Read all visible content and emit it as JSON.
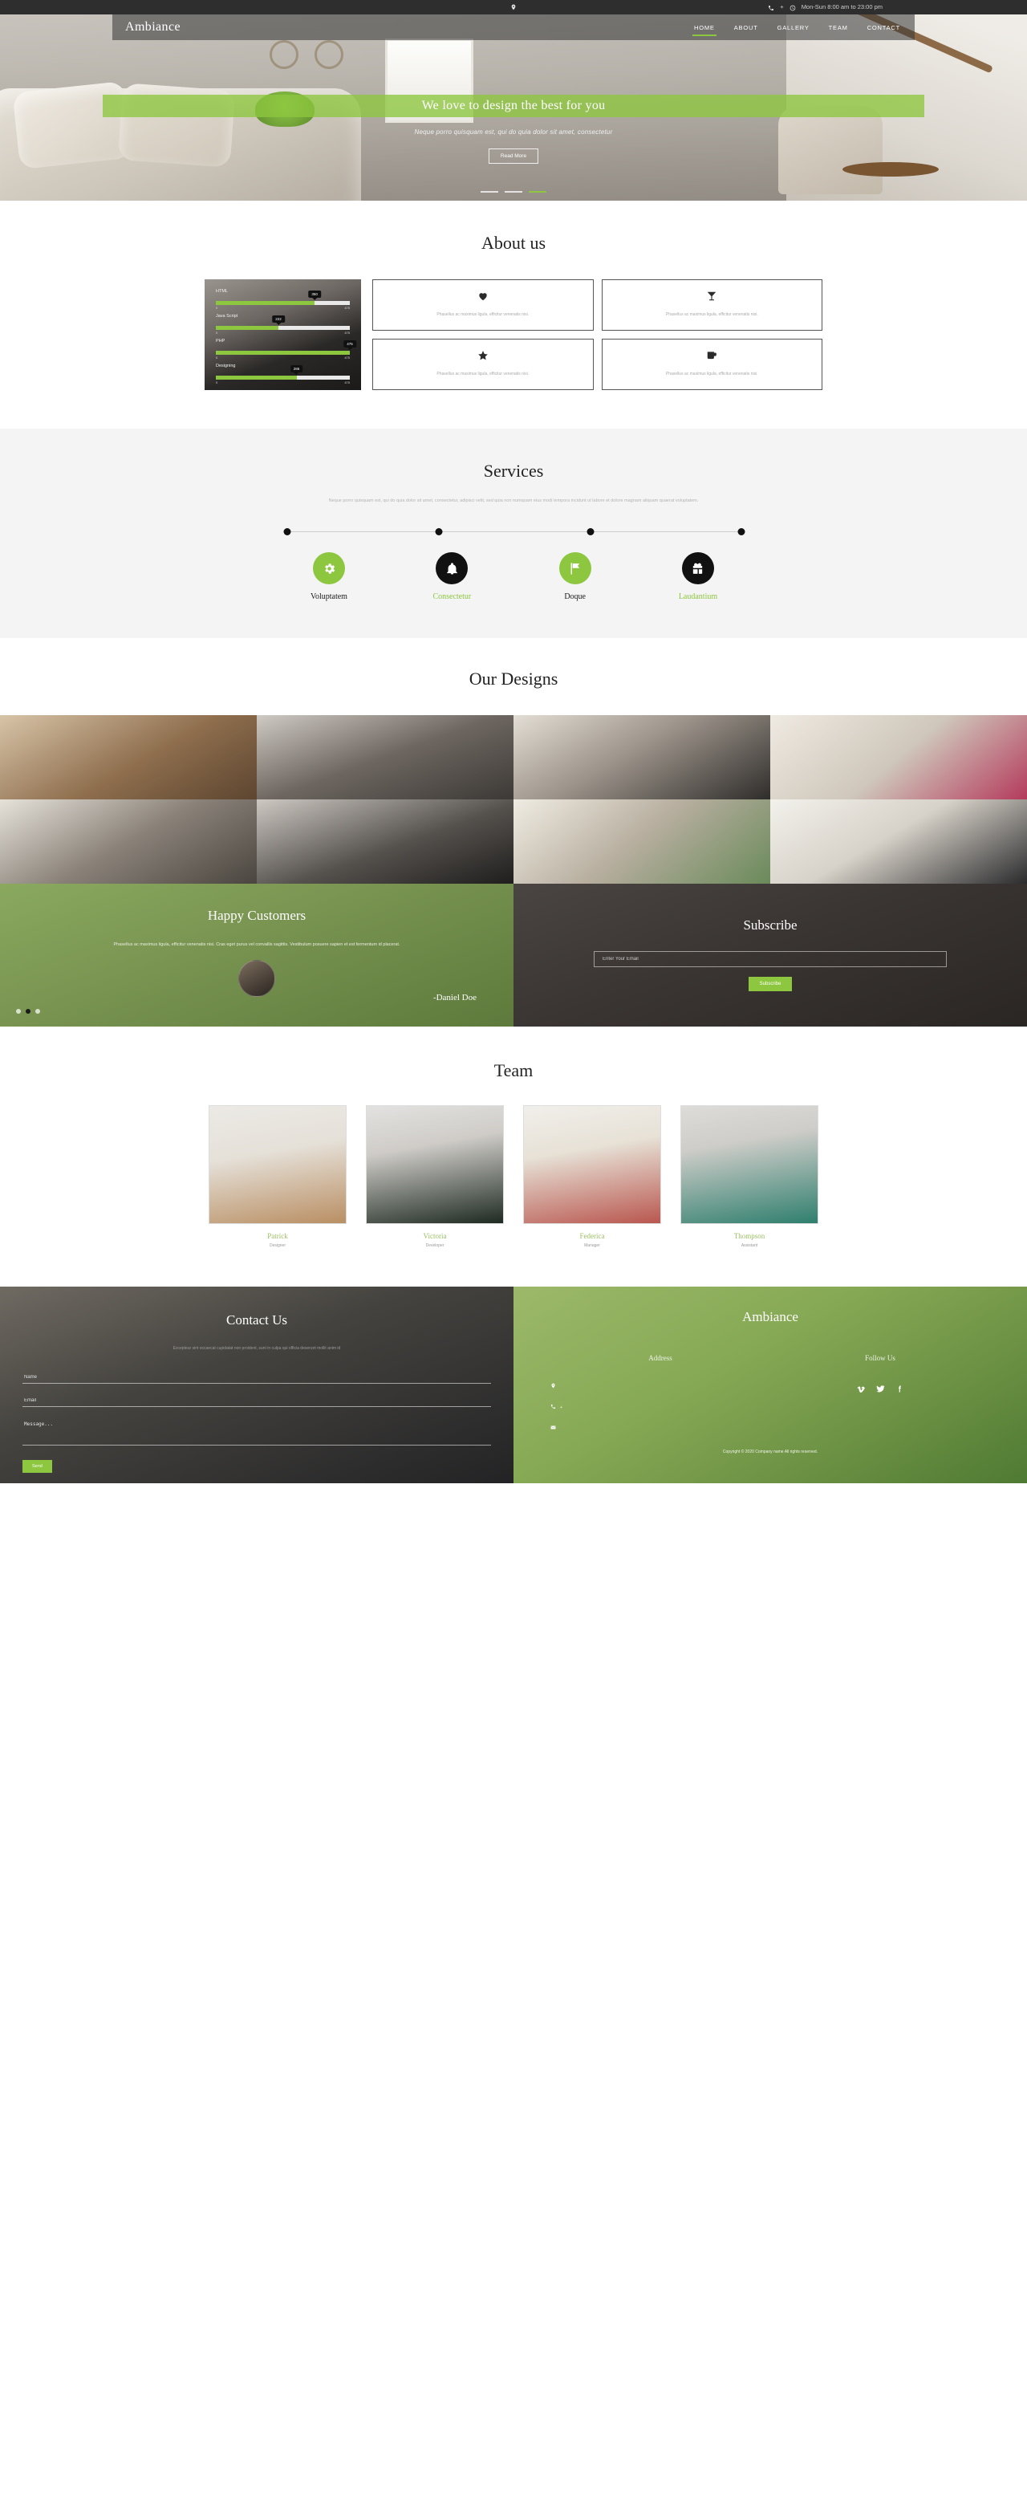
{
  "topbar": {
    "location_icon": "map-pin-icon",
    "phone_icon": "phone-icon",
    "phone": "+",
    "clock_icon": "clock-icon",
    "hours": "Mon-Sun 8:00 am to 23:00 pm"
  },
  "header": {
    "brand": "Ambiance",
    "nav": [
      {
        "label": "HOME",
        "active": true
      },
      {
        "label": "ABOUT",
        "active": false
      },
      {
        "label": "GALLERY",
        "active": false
      },
      {
        "label": "TEAM",
        "active": false
      },
      {
        "label": "CONTACT",
        "active": false
      }
    ]
  },
  "hero": {
    "title": "We love to design the best for you",
    "subtitle": "Neque porro quisquam est, qui do quia dolor sit amet, consectetur",
    "button": "Read More",
    "slide_count": 3,
    "active_slide": 3
  },
  "about": {
    "title": "About us",
    "skills": [
      {
        "name": "HTML",
        "value": 350,
        "min": "0",
        "max": "475",
        "percent": 73.7
      },
      {
        "name": "Java Script",
        "value": 222,
        "min": "0",
        "max": "475",
        "percent": 46.7
      },
      {
        "name": "PHP",
        "value": 475,
        "min": "0",
        "max": "475",
        "percent": 100
      },
      {
        "name": "Designing",
        "value": 286,
        "min": "0",
        "max": "475",
        "percent": 60.2
      }
    ],
    "features": [
      {
        "icon": "heart-icon",
        "text": "Phasellus ac maximus ligula, efficitur venenatis nisi."
      },
      {
        "icon": "cocktail-icon",
        "text": "Phasellus ac maximus ligula, efficitur venenatis nisi."
      },
      {
        "icon": "star-icon",
        "text": "Phasellus ac maximus ligula, efficitur venenatis nisi."
      },
      {
        "icon": "mug-icon",
        "text": "Phasellus ac maximus ligula, efficitur venenatis nisi."
      }
    ]
  },
  "services": {
    "title": "Services",
    "description": "Neque porro quisquam est, qui do quia dolor sit amet, consectetur, adipisci velit, sed quia non numquam eius modi tempora incidunt ut labore et dolore magnam aliquam quaerat voluptatem.",
    "items": [
      {
        "name": "Voluptatem",
        "icon": "gear-icon",
        "circle_color": "#8dc63f",
        "label_color": "#1a1a1a"
      },
      {
        "name": "Consectetur",
        "icon": "bell-icon",
        "circle_color": "#111111",
        "label_color": "#8dc63f"
      },
      {
        "name": "Doque",
        "icon": "flag-icon",
        "circle_color": "#8dc63f",
        "label_color": "#1a1a1a"
      },
      {
        "name": "Laudantium",
        "icon": "gift-icon",
        "circle_color": "#111111",
        "label_color": "#8dc63f"
      }
    ]
  },
  "designs": {
    "title": "Our Designs",
    "images": [
      "bathroom-vanity",
      "bedroom-wood-panel",
      "living-room-piano",
      "study-red-sofa",
      "bedroom-shelf",
      "media-room-dark",
      "dining-table-chairs",
      "tv-unit-white"
    ]
  },
  "testimonial": {
    "title": "Happy Customers",
    "quote": "Phasellus ac maximus ligula, efficitur venenatis nisi. Cras eget purus vel convallis sagittis. Vestibulum posuere sapien et est fermentum id placerat.",
    "author": "-Daniel Doe",
    "dots": 3,
    "active_dot": 2
  },
  "subscribe": {
    "title": "Subscribe",
    "placeholder": "Enter Your Email",
    "button": "Subscribe"
  },
  "team": {
    "title": "Team",
    "members": [
      {
        "name": "Patrick",
        "role": "Designer"
      },
      {
        "name": "Victoria",
        "role": "Developer"
      },
      {
        "name": "Federica",
        "role": "Manager"
      },
      {
        "name": "Thompson",
        "role": "Assistant"
      }
    ]
  },
  "contact": {
    "title": "Contact Us",
    "description": "Excepteur sint occaecat cupidatat non proident, sunt in culpa qui officia deserunt mollit anim id",
    "name_placeholder": "Name",
    "email_placeholder": "Email",
    "message_placeholder": "Message...",
    "button": "Send"
  },
  "footer": {
    "brand": "Ambiance",
    "address_title": "Address",
    "follow_title": "Follow Us",
    "address_rows": [
      {
        "icon": "map-pin-icon",
        "text": ""
      },
      {
        "icon": "phone-icon",
        "text": "+"
      },
      {
        "icon": "mail-icon",
        "text": ""
      }
    ],
    "social": [
      {
        "icon": "vimeo-icon"
      },
      {
        "icon": "twitter-icon"
      },
      {
        "icon": "facebook-icon"
      }
    ],
    "copyright": "Copyright © 2020 Company name All rights reserved."
  },
  "colors": {
    "accent": "#8dc63f",
    "dark": "#2e2e2e",
    "muted": "#b3b3b3"
  }
}
